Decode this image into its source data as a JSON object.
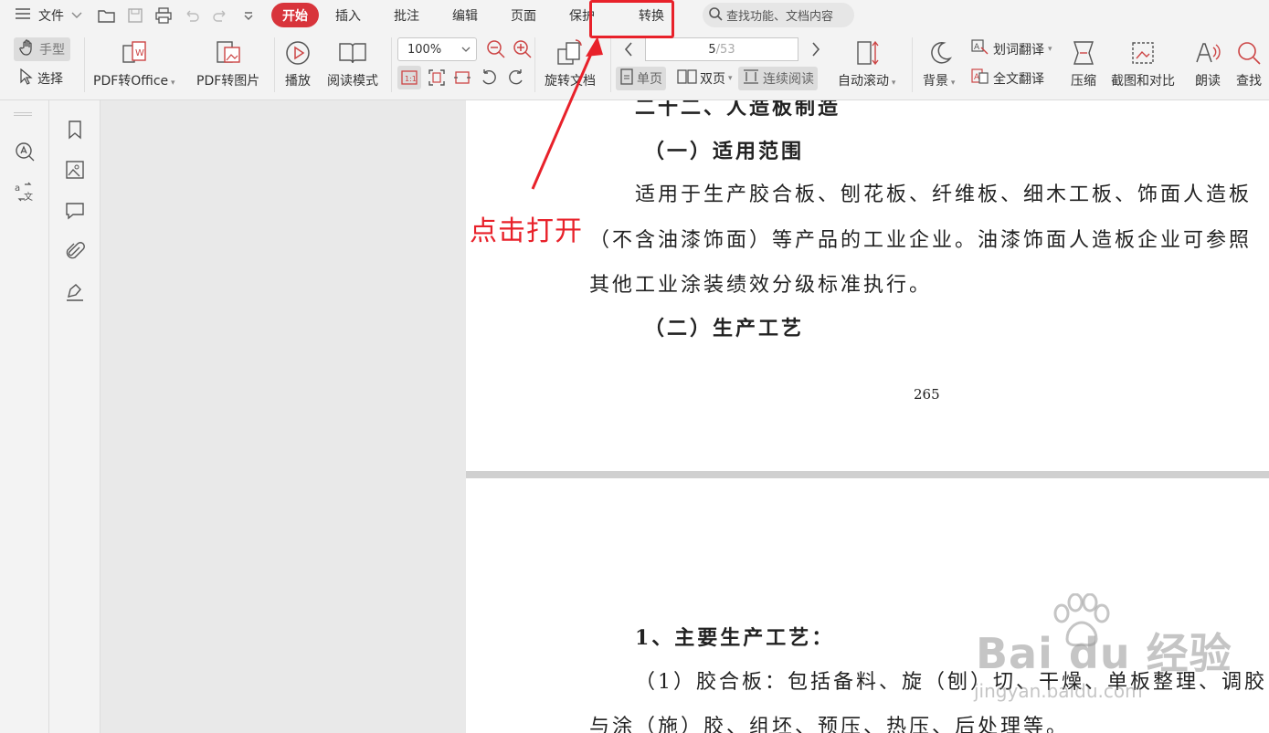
{
  "menubar": {
    "file_label": "文件",
    "tabs": [
      {
        "label": "开始",
        "active": true
      },
      {
        "label": "插入",
        "active": false
      },
      {
        "label": "批注",
        "active": false
      },
      {
        "label": "编辑",
        "active": false
      },
      {
        "label": "页面",
        "active": false
      },
      {
        "label": "保护",
        "active": false
      },
      {
        "label": "转换",
        "active": false
      }
    ],
    "search_placeholder": "查找功能、文档内容"
  },
  "ribbon": {
    "hand_label": "手型",
    "select_label": "选择",
    "pdf_to_office": "PDF转Office",
    "pdf_to_image": "PDF转图片",
    "play": "播放",
    "read_mode": "阅读模式",
    "zoom_value": "100%",
    "rotate_doc": "旋转文档",
    "page_current": "5",
    "page_total": "/53",
    "single_page": "单页",
    "double_page": "双页",
    "continuous_read": "连续阅读",
    "auto_scroll": "自动滚动",
    "background": "背景",
    "word_translate": "划词翻译",
    "full_translate": "全文翻译",
    "compress": "压缩",
    "screenshot_compare": "截图和对比",
    "read_aloud": "朗读",
    "find": "查找"
  },
  "document": {
    "heading_partial": "二十二、人造板制造",
    "section1": "（一）适用范围",
    "para1_line1": "适用于生产胶合板、刨花板、纤维板、细木工板、饰面人造板",
    "para1_line2": "（不含油漆饰面）等产品的工业企业。油漆饰面人造板企业可参照",
    "para1_line3": "其他工业涂装绩效分级标准执行。",
    "section2": "（二）生产工艺",
    "page_number": "265",
    "p2_item1": "1、主要生产工艺：",
    "p2_line1": "（1）胶合板：包括备料、旋（刨）切、干燥、单板整理、调胶",
    "p2_line2": "与涂（施）胶、组坯、预压、热压、后处理等。"
  },
  "annotation": {
    "text": "点击打开",
    "color": "#e8212a"
  },
  "watermark": {
    "main": "Bai du 经验",
    "sub": "jingyan.baidu.com"
  },
  "colors": {
    "accent": "#d8343b",
    "annotation": "#e8212a"
  }
}
